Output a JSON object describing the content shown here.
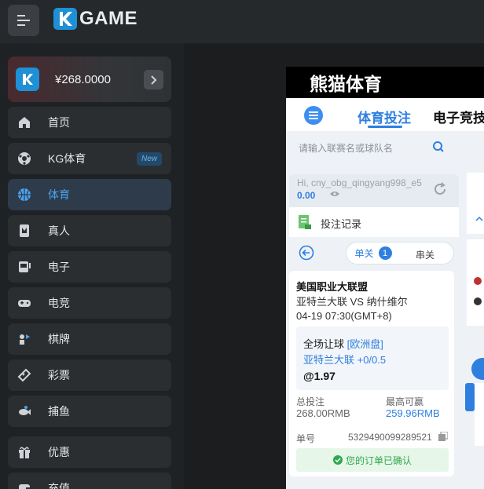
{
  "header": {
    "logo_text": "GAME",
    "logo_k": "K"
  },
  "wallet": {
    "amount": "¥268.0000"
  },
  "nav": {
    "home": "首页",
    "kg_sports": "KG体育",
    "kg_sports_badge": "New",
    "sports": "体育",
    "live": "真人",
    "slots": "电子",
    "esports": "电竞",
    "cards": "棋牌",
    "lottery": "彩票",
    "fishing": "捕鱼",
    "promos": "优惠",
    "deposit": "充值"
  },
  "panel": {
    "title": "熊猫体育",
    "tabs": {
      "sports": "体育投注",
      "esports": "电子竞技"
    },
    "search_placeholder": "请输入联赛名或球队名",
    "user": {
      "name": "Hi, cny_obg_qingyang998_e5",
      "balance": "0.00"
    },
    "bet_records_label": "投注记录",
    "mode": {
      "single": "单关",
      "single_count": "1",
      "parlay": "串关"
    }
  },
  "bet": {
    "league": "美国职业大联盟",
    "match": "亚特兰大联 VS 纳什维尔",
    "time": "04-19 07:30(GMT+8)",
    "market": "全场让球",
    "market_type": "[欧洲盘]",
    "selection": "亚特兰大联 +0/0.5",
    "odds": "@1.97",
    "stake_label": "总投注",
    "stake_value": "268.00RMB",
    "max_win_label": "最高可赢",
    "max_win_value": "259.96RMB",
    "order_label": "单号",
    "order_value": "5329490099289521",
    "status": "您的订单已确认"
  },
  "colors": {
    "accent": "#2f7fe0",
    "success": "#2fa84f",
    "sidebar": "#1f2225"
  }
}
